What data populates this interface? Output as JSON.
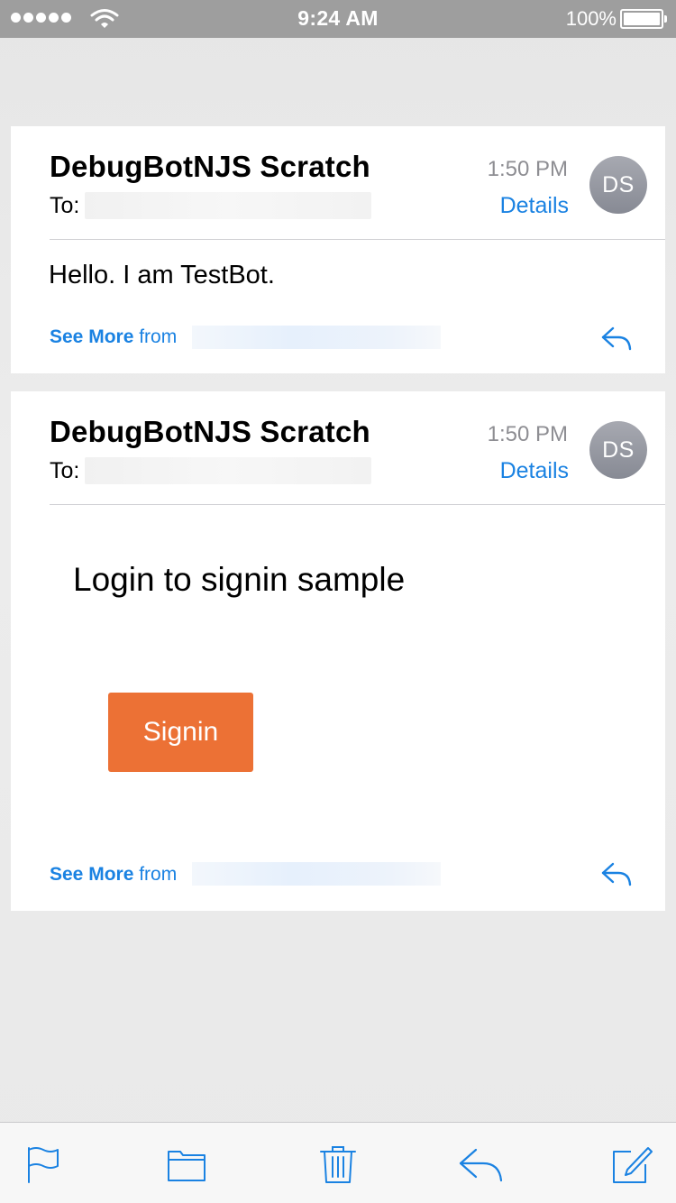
{
  "status_bar": {
    "time": "9:24 AM",
    "battery_percent": "100%",
    "signal_dots": 5,
    "battery_level": 1.0
  },
  "messages": [
    {
      "sender": "DebugBotNJS Scratch",
      "to_label": "To:",
      "time": "1:50 PM",
      "details_label": "Details",
      "avatar_initials": "DS",
      "body": "Hello. I am TestBot.",
      "see_more_label": "See More",
      "from_label": "from"
    },
    {
      "sender": "DebugBotNJS Scratch",
      "to_label": "To:",
      "time": "1:50 PM",
      "details_label": "Details",
      "avatar_initials": "DS",
      "card_text": "Login to signin sample",
      "button_label": "Signin",
      "see_more_label": "See More",
      "from_label": "from"
    }
  ],
  "toolbar": {
    "icons": [
      "flag-icon",
      "folder-icon",
      "trash-icon",
      "reply-icon",
      "compose-icon"
    ]
  },
  "colors": {
    "accent": "#1a82e2",
    "button": "#ec7135",
    "status_bar": "#9e9e9e",
    "avatar": "#9a9ca4"
  }
}
